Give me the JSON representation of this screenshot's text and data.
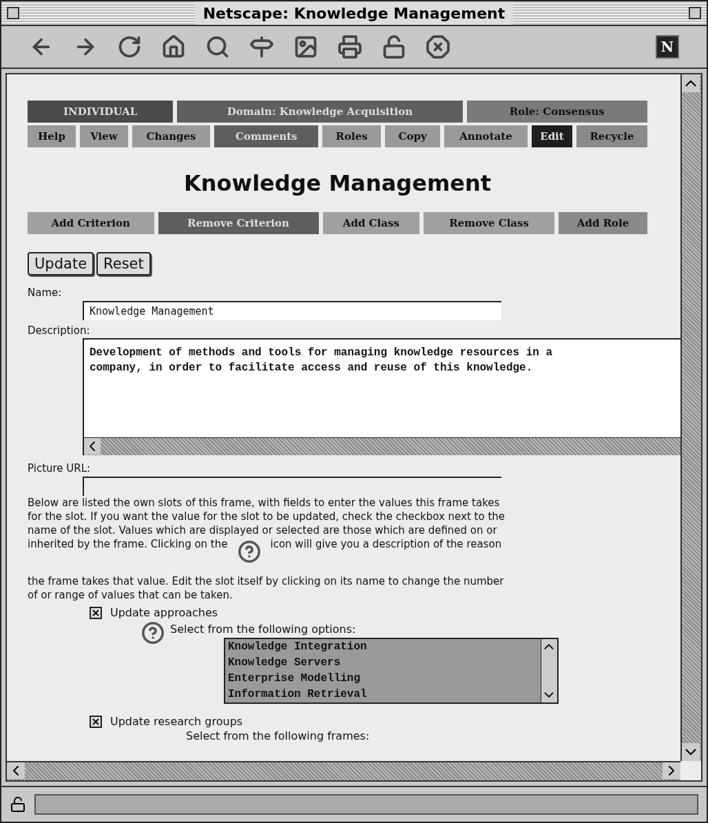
{
  "window": {
    "title": "Netscape: Knowledge Management"
  },
  "toolbar": {
    "logo": "N"
  },
  "header_bar": [
    {
      "label": "INDIVIDUAL",
      "color": "#4a4a4a"
    },
    {
      "label": "Domain: Knowledge Acquisition",
      "color": "#5e5e5e"
    },
    {
      "label": "Role: Consensus",
      "color": "#7a7a7a"
    }
  ],
  "nav_bar": [
    {
      "label": "Help",
      "color": "#9a9a9a"
    },
    {
      "label": "View",
      "color": "#9a9a9a"
    },
    {
      "label": "Changes",
      "color": "#9a9a9a"
    },
    {
      "label": "Comments",
      "color": "#5e5e5e"
    },
    {
      "label": "Roles",
      "color": "#9a9a9a"
    },
    {
      "label": "Copy",
      "color": "#9a9a9a"
    },
    {
      "label": "Annotate",
      "color": "#9a9a9a"
    },
    {
      "label": "Edit",
      "color": "#1e1e1e"
    },
    {
      "label": "Recycle",
      "color": "#8a8a8a"
    }
  ],
  "page_title": "Knowledge Management",
  "action_bar": [
    {
      "label": "Add Criterion",
      "color": "#a0a0a0"
    },
    {
      "label": "Remove Criterion",
      "color": "#5e5e5e"
    },
    {
      "label": "Add Class",
      "color": "#a0a0a0"
    },
    {
      "label": "Remove Class",
      "color": "#a0a0a0"
    },
    {
      "label": "Add Role",
      "color": "#8a8a8a"
    }
  ],
  "form_buttons": [
    "Update",
    "Reset"
  ],
  "name": {
    "label": "Name:",
    "value": "Knowledge Management"
  },
  "description": {
    "label": "Description:",
    "value": "Development of methods and tools for managing knowledge resources in a\ncompany, in order to facilitate access and reuse of this knowledge."
  },
  "picture_url": {
    "label": "Picture URL:"
  },
  "instructions": {
    "lines": [
      "Below are listed the own slots of this frame, with fields to enter the values this frame takes",
      "for the slot. If you want the value for the slot to be updated, check the checkbox next to the",
      "name of the slot. Values which are displayed or selected are those which are defined on or"
    ],
    "before_icon": "inherited by the frame. Clicking on the",
    "after_icon": "icon will give you a description of the reason",
    "continued": [
      "the frame takes that value. Edit the slot itself by clicking on its name to change the number",
      "of or range of values that can be taken."
    ]
  },
  "slots": [
    {
      "label": "Update approaches",
      "checked": true,
      "prompt": "Select from the following options:",
      "options": [
        "Knowledge Integration",
        "Knowledge Servers",
        "Enterprise Modelling",
        "Information Retrieval"
      ]
    },
    {
      "label": "Update research groups",
      "checked": true,
      "prompt": "Select from the following frames:"
    }
  ]
}
